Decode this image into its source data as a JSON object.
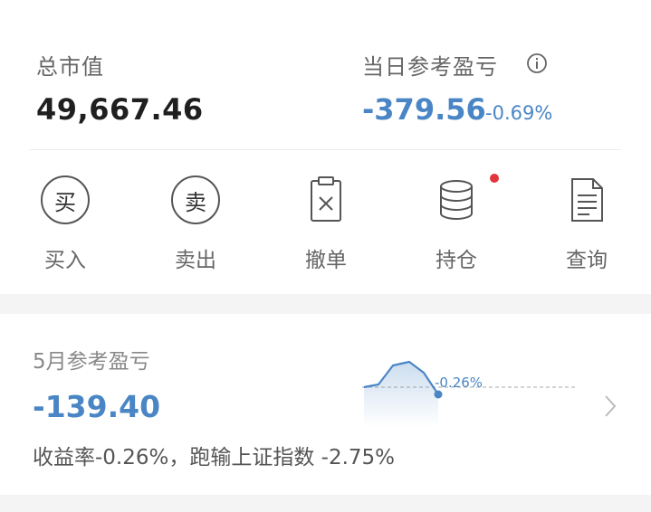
{
  "summary": {
    "total_label": "总市值",
    "total_value": "49,667.46",
    "daily_pnl_label": "当日参考盈亏",
    "daily_pnl_value": "-379.56",
    "daily_pnl_pct": "-0.69%"
  },
  "actions": [
    {
      "label": "买入",
      "glyph": "买",
      "icon": "buy-circle-icon"
    },
    {
      "label": "卖出",
      "glyph": "卖",
      "icon": "sell-circle-icon"
    },
    {
      "label": "撤单",
      "icon": "clipboard-x-icon"
    },
    {
      "label": "持仓",
      "icon": "database-stack-icon",
      "has_notification_dot": true
    },
    {
      "label": "查询",
      "icon": "document-lines-icon"
    }
  ],
  "monthly": {
    "label": "5月参考盈亏",
    "value": "-139.40",
    "note": "收益率-0.26%，跑输上证指数 -2.75%",
    "spark_label": "-0.26%"
  },
  "colors": {
    "loss_blue": "#4a86c5",
    "notification_red": "#e0363c"
  }
}
